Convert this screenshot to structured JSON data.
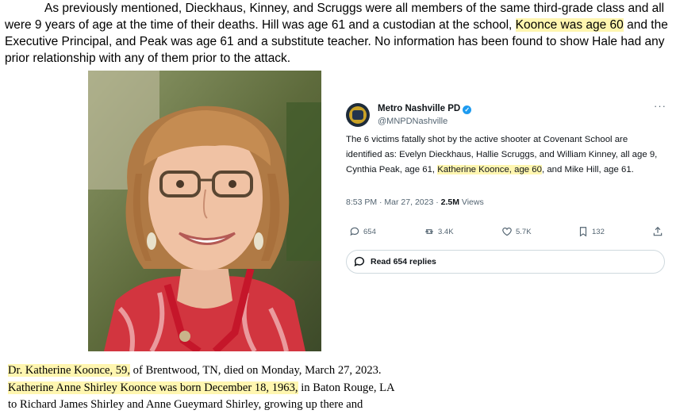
{
  "paragraph": {
    "line1": "As previously mentioned, Dieckhaus, Kinney, and Scruggs were all members of the same third-grade class and all",
    "line2a": "were 9 years of age at the time of their deaths.  Hill was age 61 and a custodian at the school, ",
    "line2_highlight": "Koonce was age 60",
    "line2b": " and the",
    "line3": "Executive Principal, and Peak was age 61 and a substitute teacher.  No information has been found to show Hale had any",
    "line4": "prior relationship with any of them prior to the attack."
  },
  "tweet": {
    "name": "Metro Nashville PD",
    "handle": "@MNPDNashville",
    "more": "···",
    "text_before": "The 6 victims fatally shot by the active shooter at Covenant School are identified as: Evelyn Dieckhaus, Hallie Scruggs, and William Kinney, all age 9, Cynthia Peak, age 61, ",
    "text_highlight": "Katherine Koonce, age 60",
    "text_after": ", and Mike Hill, age 61.",
    "timestamp": "8:53 PM · Mar 27, 2023 · ",
    "views_count": "2.5M",
    "views_label": " Views",
    "replies": "654",
    "reposts": "3.4K",
    "likes": "5.7K",
    "bookmarks": "132",
    "read_replies": "Read 654 replies"
  },
  "obituary": {
    "line1_highlight": "Dr. Katherine Koonce, 59,",
    "line1_rest": " of Brentwood, TN, died on Monday, March 27, 2023.",
    "line2_highlight": "Katherine Anne Shirley Koonce was born December 18, 1963,",
    "line2_rest": " in Baton Rouge, LA",
    "line3": "to Richard James Shirley and Anne Gueymard Shirley, growing up there and"
  },
  "colors": {
    "highlight": "#fff6b0",
    "verified": "#1d9bf0",
    "secondary_text": "#536471"
  }
}
